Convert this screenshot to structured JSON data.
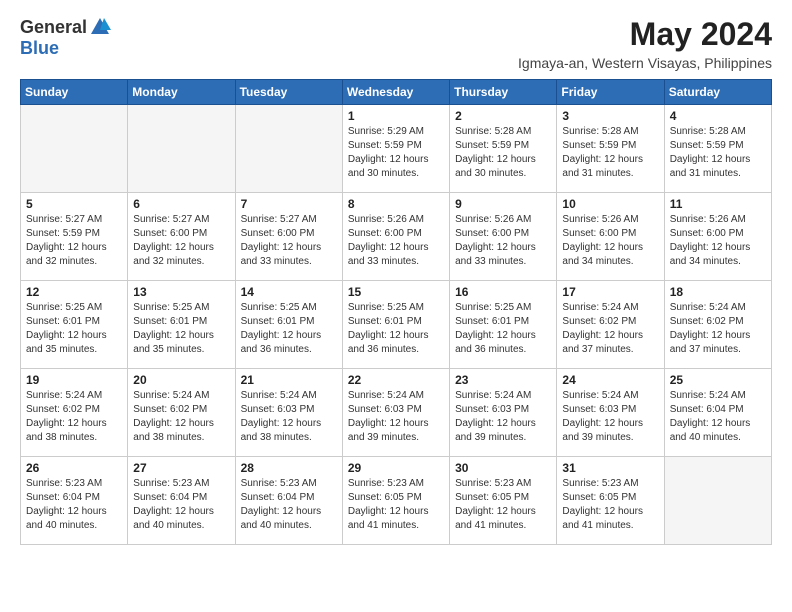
{
  "logo": {
    "general": "General",
    "blue": "Blue"
  },
  "title": {
    "month_year": "May 2024",
    "location": "Igmaya-an, Western Visayas, Philippines"
  },
  "days_of_week": [
    "Sunday",
    "Monday",
    "Tuesday",
    "Wednesday",
    "Thursday",
    "Friday",
    "Saturday"
  ],
  "weeks": [
    [
      {
        "day": "",
        "empty": true
      },
      {
        "day": "",
        "empty": true
      },
      {
        "day": "",
        "empty": true
      },
      {
        "day": "1",
        "sunrise": "5:29 AM",
        "sunset": "5:59 PM",
        "daylight": "12 hours and 30 minutes."
      },
      {
        "day": "2",
        "sunrise": "5:28 AM",
        "sunset": "5:59 PM",
        "daylight": "12 hours and 30 minutes."
      },
      {
        "day": "3",
        "sunrise": "5:28 AM",
        "sunset": "5:59 PM",
        "daylight": "12 hours and 31 minutes."
      },
      {
        "day": "4",
        "sunrise": "5:28 AM",
        "sunset": "5:59 PM",
        "daylight": "12 hours and 31 minutes."
      }
    ],
    [
      {
        "day": "5",
        "sunrise": "5:27 AM",
        "sunset": "5:59 PM",
        "daylight": "12 hours and 32 minutes."
      },
      {
        "day": "6",
        "sunrise": "5:27 AM",
        "sunset": "6:00 PM",
        "daylight": "12 hours and 32 minutes."
      },
      {
        "day": "7",
        "sunrise": "5:27 AM",
        "sunset": "6:00 PM",
        "daylight": "12 hours and 33 minutes."
      },
      {
        "day": "8",
        "sunrise": "5:26 AM",
        "sunset": "6:00 PM",
        "daylight": "12 hours and 33 minutes."
      },
      {
        "day": "9",
        "sunrise": "5:26 AM",
        "sunset": "6:00 PM",
        "daylight": "12 hours and 33 minutes."
      },
      {
        "day": "10",
        "sunrise": "5:26 AM",
        "sunset": "6:00 PM",
        "daylight": "12 hours and 34 minutes."
      },
      {
        "day": "11",
        "sunrise": "5:26 AM",
        "sunset": "6:00 PM",
        "daylight": "12 hours and 34 minutes."
      }
    ],
    [
      {
        "day": "12",
        "sunrise": "5:25 AM",
        "sunset": "6:01 PM",
        "daylight": "12 hours and 35 minutes."
      },
      {
        "day": "13",
        "sunrise": "5:25 AM",
        "sunset": "6:01 PM",
        "daylight": "12 hours and 35 minutes."
      },
      {
        "day": "14",
        "sunrise": "5:25 AM",
        "sunset": "6:01 PM",
        "daylight": "12 hours and 36 minutes."
      },
      {
        "day": "15",
        "sunrise": "5:25 AM",
        "sunset": "6:01 PM",
        "daylight": "12 hours and 36 minutes."
      },
      {
        "day": "16",
        "sunrise": "5:25 AM",
        "sunset": "6:01 PM",
        "daylight": "12 hours and 36 minutes."
      },
      {
        "day": "17",
        "sunrise": "5:24 AM",
        "sunset": "6:02 PM",
        "daylight": "12 hours and 37 minutes."
      },
      {
        "day": "18",
        "sunrise": "5:24 AM",
        "sunset": "6:02 PM",
        "daylight": "12 hours and 37 minutes."
      }
    ],
    [
      {
        "day": "19",
        "sunrise": "5:24 AM",
        "sunset": "6:02 PM",
        "daylight": "12 hours and 38 minutes."
      },
      {
        "day": "20",
        "sunrise": "5:24 AM",
        "sunset": "6:02 PM",
        "daylight": "12 hours and 38 minutes."
      },
      {
        "day": "21",
        "sunrise": "5:24 AM",
        "sunset": "6:03 PM",
        "daylight": "12 hours and 38 minutes."
      },
      {
        "day": "22",
        "sunrise": "5:24 AM",
        "sunset": "6:03 PM",
        "daylight": "12 hours and 39 minutes."
      },
      {
        "day": "23",
        "sunrise": "5:24 AM",
        "sunset": "6:03 PM",
        "daylight": "12 hours and 39 minutes."
      },
      {
        "day": "24",
        "sunrise": "5:24 AM",
        "sunset": "6:03 PM",
        "daylight": "12 hours and 39 minutes."
      },
      {
        "day": "25",
        "sunrise": "5:24 AM",
        "sunset": "6:04 PM",
        "daylight": "12 hours and 40 minutes."
      }
    ],
    [
      {
        "day": "26",
        "sunrise": "5:23 AM",
        "sunset": "6:04 PM",
        "daylight": "12 hours and 40 minutes."
      },
      {
        "day": "27",
        "sunrise": "5:23 AM",
        "sunset": "6:04 PM",
        "daylight": "12 hours and 40 minutes."
      },
      {
        "day": "28",
        "sunrise": "5:23 AM",
        "sunset": "6:04 PM",
        "daylight": "12 hours and 40 minutes."
      },
      {
        "day": "29",
        "sunrise": "5:23 AM",
        "sunset": "6:05 PM",
        "daylight": "12 hours and 41 minutes."
      },
      {
        "day": "30",
        "sunrise": "5:23 AM",
        "sunset": "6:05 PM",
        "daylight": "12 hours and 41 minutes."
      },
      {
        "day": "31",
        "sunrise": "5:23 AM",
        "sunset": "6:05 PM",
        "daylight": "12 hours and 41 minutes."
      },
      {
        "day": "",
        "empty": true
      }
    ]
  ],
  "labels": {
    "sunrise": "Sunrise:",
    "sunset": "Sunset:",
    "daylight": "Daylight:"
  }
}
